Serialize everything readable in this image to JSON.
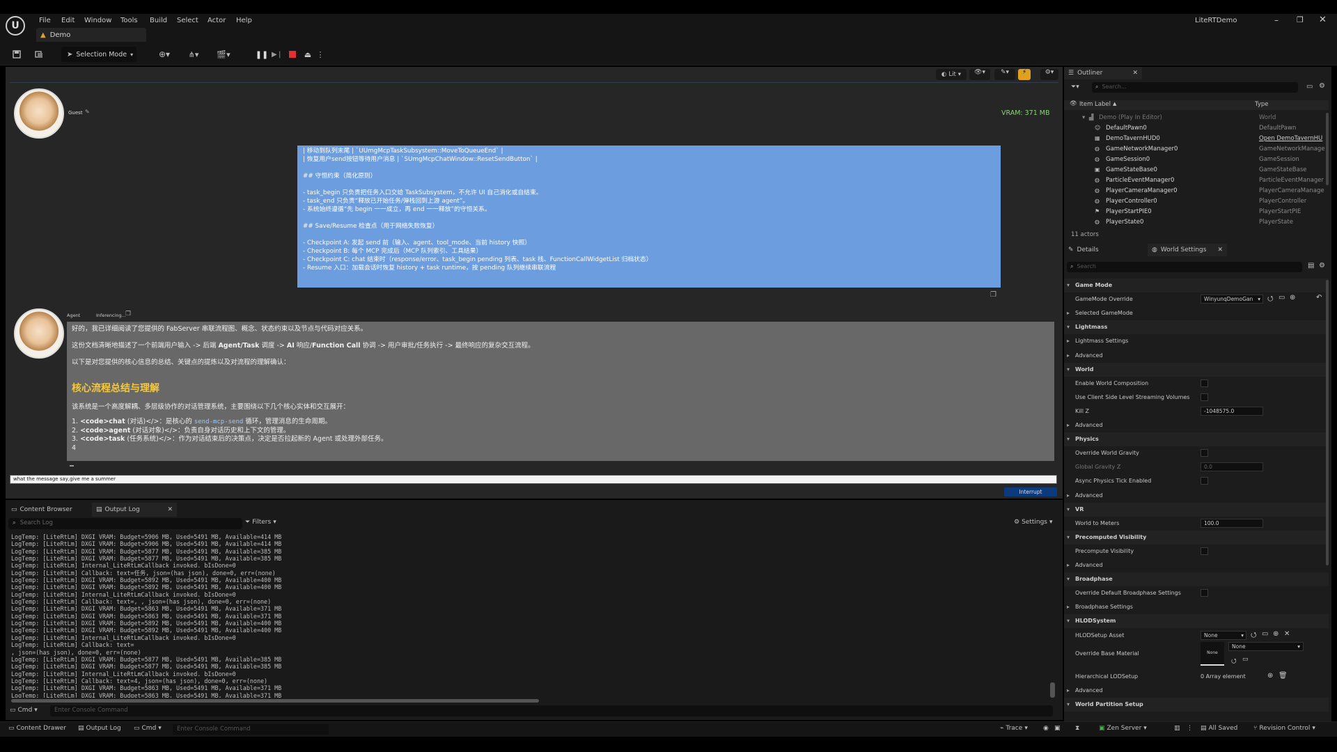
{
  "window": {
    "title": "LiteRTDemo",
    "tab": "Demo"
  },
  "menu": [
    "File",
    "Edit",
    "Window",
    "Tools",
    "Build",
    "Select",
    "Actor",
    "Help"
  ],
  "toolbar": {
    "selection_mode": "Selection Mode"
  },
  "viewport": {
    "view_mode": "Lit",
    "vram": "VRAM: 371 MB"
  },
  "chat": {
    "guest_name": "Guest",
    "agent_name": "Agent",
    "agent_status": "Inferencing...",
    "user_message": [
      "| 移动到队列末尾 | `UUmgMcpTaskSubsystem::MoveToQueueEnd` |",
      "| 恢复用户send按钮等待用户消息 | `SUmgMcpChatWindow::ResetSendButton` |",
      "",
      "## 守恒约束（简化原则）",
      "",
      "- task_begin 只负责把任务入口交给 TaskSubsystem，不允许 UI 自己消化或自结束。",
      "- task_end 只负责“释放已开始任务/弹栈回到上游 agent”。",
      "- 系统始终遵循“先 begin 一一成立，再 end 一一释放”的守恒关系。",
      "",
      "## Save/Resume 检查点（用于网络失败恢复）",
      "",
      "- Checkpoint A: 发起 send 前（输入、agent、tool_mode、当前 history 快照）",
      "- Checkpoint B: 每个 MCP 完成后（MCP 队列索引、工具结果）",
      "- Checkpoint C: chat 结束时（response/error、task_begin pending 列表、task 栈、FunctionCallWidgetList 归档状态）",
      "- Resume 入口：加载会话时恢复 history + task runtime，按 pending 队列继续串联流程"
    ],
    "agent_intro_1": "好的，我已详细阅读了您提供的 FabServer 串联流程图、概念、状态约束以及节点与代码对应关系。",
    "agent_intro_2a": "这份文档清晰地描述了一个前端用户输入 -> 后端 ",
    "agent_intro_2b": "Agent/Task",
    "agent_intro_2c": " 调度 -> ",
    "agent_intro_2d": "AI",
    "agent_intro_2e": " 响应/",
    "agent_intro_2f": "Function Call",
    "agent_intro_2g": " 协调 -> 用户审批/任务执行 -> 最终响应的复杂交互流程。",
    "agent_intro_3": "以下是对您提供的核心信息的总结、关键点的提炼以及对流程的理解确认：",
    "agent_heading": "核心流程总结与理解",
    "agent_summary": "该系统是一个高度解耦、多层级协作的对话管理系统，主要围绕以下几个核心实体和交互展开：",
    "list": [
      {
        "num": "1.",
        "tag": "<code>chat",
        "rest": " (对话)</>：是核心的 ",
        "code": "send-mcp-send",
        "tail": " 循环，管理消息的生命周期。"
      },
      {
        "num": "2.",
        "tag": "<code>agent",
        "rest": " (对话对象)</>：负责自身对话历史和上下文的管理。",
        "code": "",
        "tail": ""
      },
      {
        "num": "3.",
        "tag": "<code>task",
        "rest": " (任务系统)</>：作为对话结束后的决策点，决定是否拉起新的 Agent 或处理外部任务。",
        "code": "",
        "tail": ""
      },
      {
        "num": "4",
        "tag": "",
        "rest": "",
        "code": "",
        "tail": ""
      }
    ],
    "input_value": "what the message say,give me a summer",
    "interrupt_label": "Interrupt"
  },
  "bottom_tabs": {
    "content_browser": "Content Browser",
    "output_log": "Output Log"
  },
  "log": {
    "search_placeholder": "Search Log",
    "filters": "Filters",
    "settings": "Settings",
    "lines": [
      "LogTemp: [LiteRtLm] DXGI VRAM: Budget=5906 MB, Used=5491 MB, Available=414 MB",
      "LogTemp: [LiteRtLm] DXGI VRAM: Budget=5906 MB, Used=5491 MB, Available=414 MB",
      "LogTemp: [LiteRtLm] DXGI VRAM: Budget=5877 MB, Used=5491 MB, Available=385 MB",
      "LogTemp: [LiteRtLm] DXGI VRAM: Budget=5877 MB, Used=5491 MB, Available=385 MB",
      "LogTemp: [LiteRtLm] Internal_LiteRtLmCallback invoked. bIsDone=0",
      "LogTemp: [LiteRtLm] Callback: text=任务, json=(has json), done=0, err=(none)",
      "LogTemp: [LiteRtLm] DXGI VRAM: Budget=5892 MB, Used=5491 MB, Available=400 MB",
      "LogTemp: [LiteRtLm] DXGI VRAM: Budget=5892 MB, Used=5491 MB, Available=400 MB",
      "LogTemp: [LiteRtLm] Internal_LiteRtLmCallback invoked. bIsDone=0",
      "LogTemp: [LiteRtLm] Callback: text=, , json=(has json), done=0, err=(none)",
      "LogTemp: [LiteRtLm] DXGI VRAM: Budget=5863 MB, Used=5491 MB, Available=371 MB",
      "LogTemp: [LiteRtLm] DXGI VRAM: Budget=5863 MB, Used=5491 MB, Available=371 MB",
      "LogTemp: [LiteRtLm] DXGI VRAM: Budget=5892 MB, Used=5491 MB, Available=400 MB",
      "LogTemp: [LiteRtLm] DXGI VRAM: Budget=5892 MB, Used=5491 MB, Available=400 MB",
      "LogTemp: [LiteRtLm] Internal_LiteRtLmCallback invoked. bIsDone=0",
      "LogTemp: [LiteRtLm] Callback: text=",
      ", json=(has json), done=0, err=(none)",
      "LogTemp: [LiteRtLm] DXGI VRAM: Budget=5877 MB, Used=5491 MB, Available=385 MB",
      "LogTemp: [LiteRtLm] DXGI VRAM: Budget=5877 MB, Used=5491 MB, Available=385 MB",
      "LogTemp: [LiteRtLm] Internal_LiteRtLmCallback invoked. bIsDone=0",
      "LogTemp: [LiteRtLm] Callback: text=4, json=(has json), done=0, err=(none)",
      "LogTemp: [LiteRtLm] DXGI VRAM: Budget=5863 MB, Used=5491 MB, Available=371 MB",
      "LogTemp: [LiteRtLm] DXGI VRAM: Budget=5863 MB, Used=5491 MB, Available=371 MB"
    ],
    "cmd_label": "Cmd",
    "console_placeholder": "Enter Console Command"
  },
  "statusbar": {
    "content_drawer": "Content Drawer",
    "output_log": "Output Log",
    "cmd": "Cmd",
    "console_placeholder": "Enter Console Command",
    "trace": "Trace",
    "zen_server": "Zen Server",
    "all_saved": "All Saved",
    "revision_control": "Revision Control"
  },
  "outliner": {
    "title": "Outliner",
    "search_placeholder": "Search...",
    "col_label": "Item Label",
    "col_type": "Type",
    "root": {
      "name": "Demo (Play In Editor)",
      "type": "World"
    },
    "items": [
      {
        "name": "DefaultPawn0",
        "type": "DefaultPawn"
      },
      {
        "name": "DemoTavernHUD0",
        "type": "Open DemoTavernHU"
      },
      {
        "name": "GameNetworkManager0",
        "type": "GameNetworkManage"
      },
      {
        "name": "GameSession0",
        "type": "GameSession"
      },
      {
        "name": "GameStateBase0",
        "type": "GameStateBase"
      },
      {
        "name": "ParticleEventManager0",
        "type": "ParticleEventManager"
      },
      {
        "name": "PlayerCameraManager0",
        "type": "PlayerCameraManage"
      },
      {
        "name": "PlayerController0",
        "type": "PlayerController"
      },
      {
        "name": "PlayerStartPIE0",
        "type": "PlayerStartPIE"
      },
      {
        "name": "PlayerState0",
        "type": "PlayerState"
      }
    ],
    "count": "11 actors"
  },
  "details": {
    "tab_details": "Details",
    "tab_world": "World Settings",
    "search_placeholder": "Search",
    "rows": [
      {
        "label": "Game Mode",
        "kind": "cat"
      },
      {
        "label": "GameMode Override",
        "kind": "dropdown",
        "value": "WinyunqDemoGan"
      },
      {
        "label": "Selected GameMode",
        "kind": "sub"
      },
      {
        "label": "Lightmass",
        "kind": "cat"
      },
      {
        "label": "Lightmass Settings",
        "kind": "sub"
      },
      {
        "label": "Advanced",
        "kind": "sub"
      },
      {
        "label": "World",
        "kind": "cat"
      },
      {
        "label": "Enable World Composition",
        "kind": "check"
      },
      {
        "label": "Use Client Side Level Streaming Volumes",
        "kind": "check"
      },
      {
        "label": "Kill Z",
        "kind": "field",
        "value": "-1048575.0"
      },
      {
        "label": "Advanced",
        "kind": "sub"
      },
      {
        "label": "Physics",
        "kind": "cat"
      },
      {
        "label": "Override World Gravity",
        "kind": "check"
      },
      {
        "label": "Global Gravity Z",
        "kind": "fielddim",
        "value": "0.0"
      },
      {
        "label": "Async Physics Tick Enabled",
        "kind": "check"
      },
      {
        "label": "Advanced",
        "kind": "sub"
      },
      {
        "label": "VR",
        "kind": "cat"
      },
      {
        "label": "World to Meters",
        "kind": "field",
        "value": "100.0"
      },
      {
        "label": "Precomputed Visibility",
        "kind": "cat"
      },
      {
        "label": "Precompute Visibility",
        "kind": "check"
      },
      {
        "label": "Advanced",
        "kind": "sub"
      },
      {
        "label": "Broadphase",
        "kind": "cat"
      },
      {
        "label": "Override Default Broadphase Settings",
        "kind": "check"
      },
      {
        "label": "Broadphase Settings",
        "kind": "sub"
      },
      {
        "label": "HLODSystem",
        "kind": "cat"
      },
      {
        "label": "HLODSetup Asset",
        "kind": "dropdown",
        "value": "None"
      }
    ],
    "material_label": "Override Base Material",
    "material_thumb": "None",
    "material_value": "None",
    "lod_label": "Hierarchical LODSetup",
    "lod_value": "0 Array element",
    "advanced2": "Advanced",
    "world_partition": "World Partition Setup"
  }
}
